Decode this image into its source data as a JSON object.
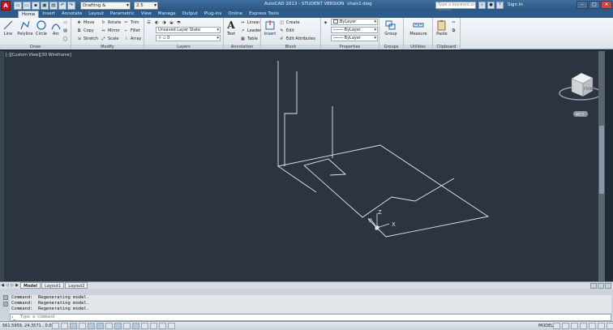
{
  "app": {
    "logo_letter": "A",
    "window_title": "AutoCAD 2013 - STUDENT VERSION",
    "file_name": "chair2.dwg",
    "workspace": "Drafting & Annotation",
    "version_box": "2.5",
    "search_placeholder": "Type a keyword or phrase",
    "sign_in": "Sign In"
  },
  "ribbon_tabs": [
    "Home",
    "Insert",
    "Annotate",
    "Layout",
    "Parametric",
    "View",
    "Manage",
    "Output",
    "Plug-ins",
    "Online",
    "Express Tools"
  ],
  "ribbon": {
    "draw": {
      "title": "Draw",
      "line": "Line",
      "polyline": "Polyline",
      "circle": "Circle",
      "arc": "Arc"
    },
    "modify": {
      "title": "Modify",
      "move": "Move",
      "rotate": "Rotate",
      "trim": "Trim",
      "copy": "Copy",
      "mirror": "Mirror",
      "fillet": "Fillet",
      "stretch": "Stretch",
      "scale": "Scale",
      "array": "Array"
    },
    "layers": {
      "title": "Layers",
      "layer_state": "Unsaved Layer State",
      "current_layer": "0"
    },
    "annotation": {
      "title": "Annotation",
      "text": "Text",
      "linear": "Linear",
      "leader": "Leader",
      "table": "Table"
    },
    "block": {
      "title": "Block",
      "insert": "Insert",
      "create": "Create",
      "edit": "Edit",
      "edit_attributes": "Edit Attributes"
    },
    "properties": {
      "title": "Properties",
      "color": "ByLayer",
      "linetype": "ByLayer",
      "lineweight": "ByLayer"
    },
    "groups": {
      "title": "Groups",
      "group": "Group"
    },
    "utilities": {
      "title": "Utilities",
      "measure": "Measure"
    },
    "clipboard": {
      "title": "Clipboard",
      "paste": "Paste"
    }
  },
  "viewport": {
    "label": "[-][Custom View][3D Wireframe]",
    "viewcube_face": "FRONT",
    "wcs_label": "WCS",
    "ucs_x": "X",
    "ucs_y": "Y",
    "ucs_z": "Z"
  },
  "layout_tabs": [
    "Model",
    "Layout1",
    "Layout2"
  ],
  "command_history": [
    "Command:  Regenerating model.",
    "Command:  Regenerating model.",
    "Command:  Regenerating model."
  ],
  "command_prompt": "Type a command",
  "status": {
    "coordinates": "561.5959, 24.3571 , 0.0000",
    "space": "MODEL"
  }
}
